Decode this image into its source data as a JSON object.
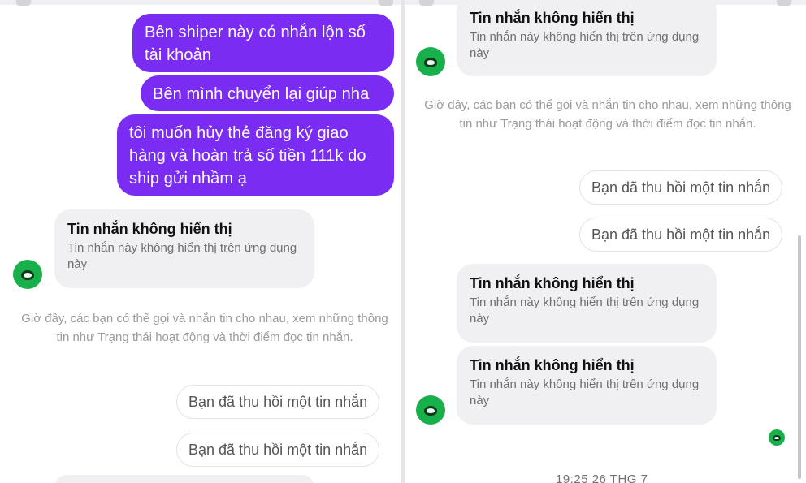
{
  "left": {
    "outgoing": [
      "Bên shiper này có nhắn lộn số tài khoản",
      "Bên mình chuyển lại giúp nha",
      "tôi muốn hủy thẻ đăng ký giao hàng và hoàn trả số tiền 111k do ship gửi nhầm ạ"
    ],
    "hidden_message": {
      "title": "Tin nhắn không hiển thị",
      "body": "Tin nhắn này không hiển thị trên ứng dụng này"
    },
    "system_note": "Giờ đây, các bạn có thể gọi và nhắn tin cho nhau, xem những thông tin như Trạng thái hoạt động và thời điểm đọc tin nhắn.",
    "recalled": [
      "Bạn đã thu hồi một tin nhắn",
      "Bạn đã thu hồi một tin nhắn"
    ],
    "avatar_icon": "ghtk-logo-icon"
  },
  "right": {
    "hidden_message_top": {
      "title": "Tin nhắn không hiển thị",
      "body": "Tin nhắn này không hiển thị trên ứng dụng này"
    },
    "system_note": "Giờ đây, các bạn có thể gọi và nhắn tin cho nhau, xem những thông tin như Trạng thái hoạt động và thời điểm đọc tin nhắn.",
    "recalled": [
      "Bạn đã thu hồi một tin nhắn",
      "Bạn đã thu hồi một tin nhắn"
    ],
    "hidden_messages": [
      {
        "title": "Tin nhắn không hiển thị",
        "body": "Tin nhắn này không hiển thị trên ứng dụng này"
      },
      {
        "title": "Tin nhắn không hiển thị",
        "body": "Tin nhắn này không hiển thị trên ứng dụng này"
      }
    ],
    "timestamp": "19:25 26 THG 7",
    "avatar_icon": "ghtk-logo-icon"
  },
  "colors": {
    "outgoing_bubble": "#7a2cf2",
    "incoming_bubble": "#f0f0f2",
    "avatar": "#18b04a"
  }
}
